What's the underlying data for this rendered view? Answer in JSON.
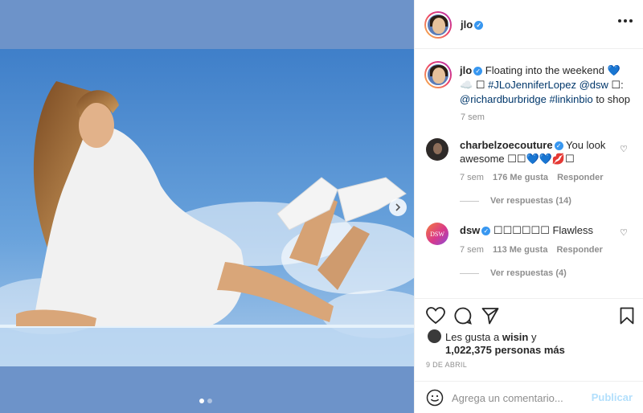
{
  "post": {
    "username": "jlo",
    "verified_icon": "verified-badge",
    "caption": {
      "username": "jlo",
      "text_1": "Floating into the weekend",
      "blue_heart": "💙",
      "cloud": "☁️",
      "box1": "☐",
      "hashtag_1": "#JLoJenniferLopez",
      "mention_1": "@dsw",
      "box2": "☐:",
      "mention_2": "@richardburbridge",
      "hashtag_2": "#linkinbio",
      "text_2": "to shop",
      "time": "7 sem"
    },
    "comments": [
      {
        "username": "charbelzoecouture",
        "text": "You look awesome ☐☐💙💙💋☐",
        "time": "7 sem",
        "likes": "176 Me gusta",
        "reply": "Responder",
        "view_replies": "Ver respuestas (14)"
      },
      {
        "username": "dsw",
        "avatar_text": "DSW",
        "text": "☐☐☐☐☐☐ Flawless",
        "time": "7 sem",
        "likes": "113 Me gusta",
        "reply": "Responder",
        "view_replies": "Ver respuestas (4)"
      }
    ],
    "likes": {
      "prefix": "Les gusta a",
      "user": "wisin",
      "suffix": "y",
      "count": "1,022,375 personas más"
    },
    "date": "9 DE ABRIL",
    "add_comment": {
      "placeholder": "Agrega un comentario...",
      "post_label": "Publicar"
    },
    "carousel": {
      "current": 1,
      "total": 2
    },
    "colors": {
      "accent_blue": "#3897f0",
      "link": "#00376b",
      "post_button_disabled": "#b2dffc",
      "sky": "#6d93c9"
    }
  }
}
